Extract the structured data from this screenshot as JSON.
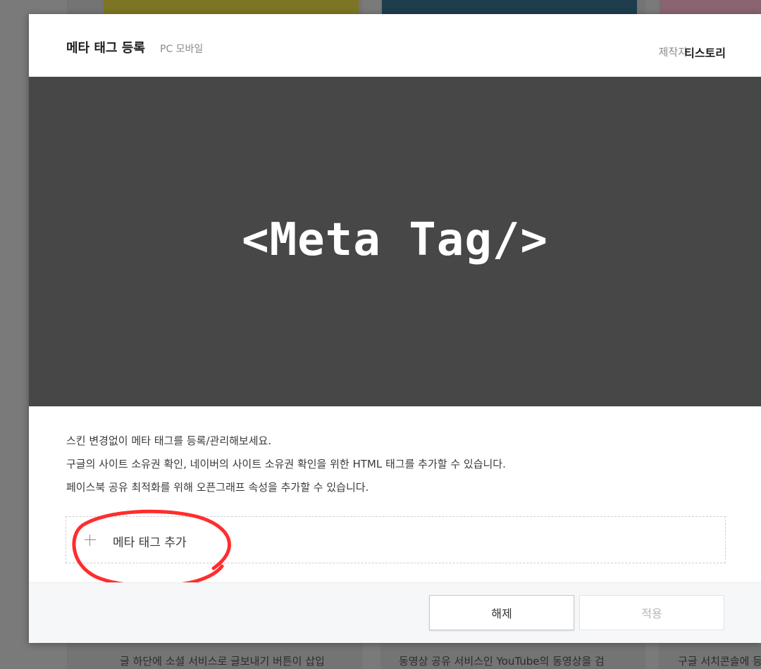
{
  "modal": {
    "title": "메타 태그 등록",
    "subtitle": "PC 모바일",
    "author_label": "제작자",
    "author_name": "티스토리",
    "preview_text": "<Meta Tag/>",
    "description": [
      "스킨 변경없이 메타 태그를 등록/관리해보세요.",
      "구글의 사이트 소유권 확인, 네이버의 사이트 소유권 확인을 위한 HTML 태그를 추가할 수 있습니다.",
      "페이스북 공유 최적화를 위해 오픈그래프 속성을 추가할 수 있습니다."
    ],
    "add_label": "메타 태그 추가",
    "cancel_label": "해제",
    "apply_label": "적용"
  },
  "background": {
    "card_descriptions": [
      "글 하단에 소셜 서비스로 글보내기 버튼이 삽입",
      "동영상 공유 서비스인 YouTube의 동영상을 검",
      "구글 서치콘솔에 등"
    ]
  },
  "colors": {
    "preview_bg": "#474747",
    "annotation": "#ff2d2d",
    "overlay": "#6f6f6f"
  },
  "icons": {
    "add": "plus-icon"
  }
}
